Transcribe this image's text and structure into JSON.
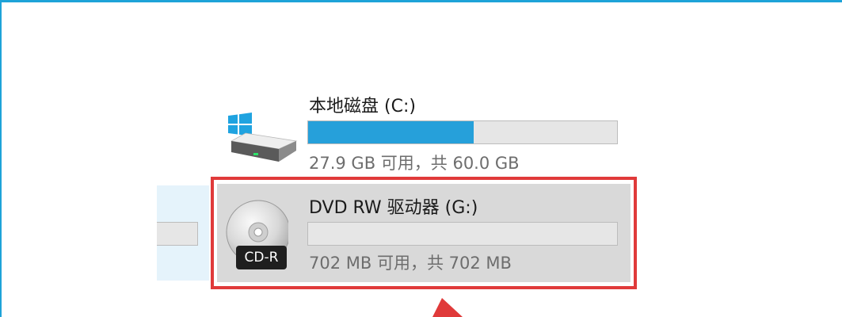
{
  "drives": [
    {
      "name": "本地磁盘 (C:)",
      "free_text": "27.9 GB 可用，共 60.0 GB",
      "used_fraction": 0.535,
      "bar_color": "#26a0da",
      "icon": "hard-drive-windows-icon"
    },
    {
      "name": "DVD RW 驱动器 (G:)",
      "free_text": "702 MB 可用，共 702 MB",
      "used_fraction": 0,
      "icon": "cd-disc-icon",
      "badge": "CD-R",
      "selected": true
    }
  ],
  "colors": {
    "window_border": "#1ea3d8",
    "highlight": "#e03a3a",
    "selection_bg": "#d9d9d9",
    "hover_bg": "#e5f3fb"
  }
}
